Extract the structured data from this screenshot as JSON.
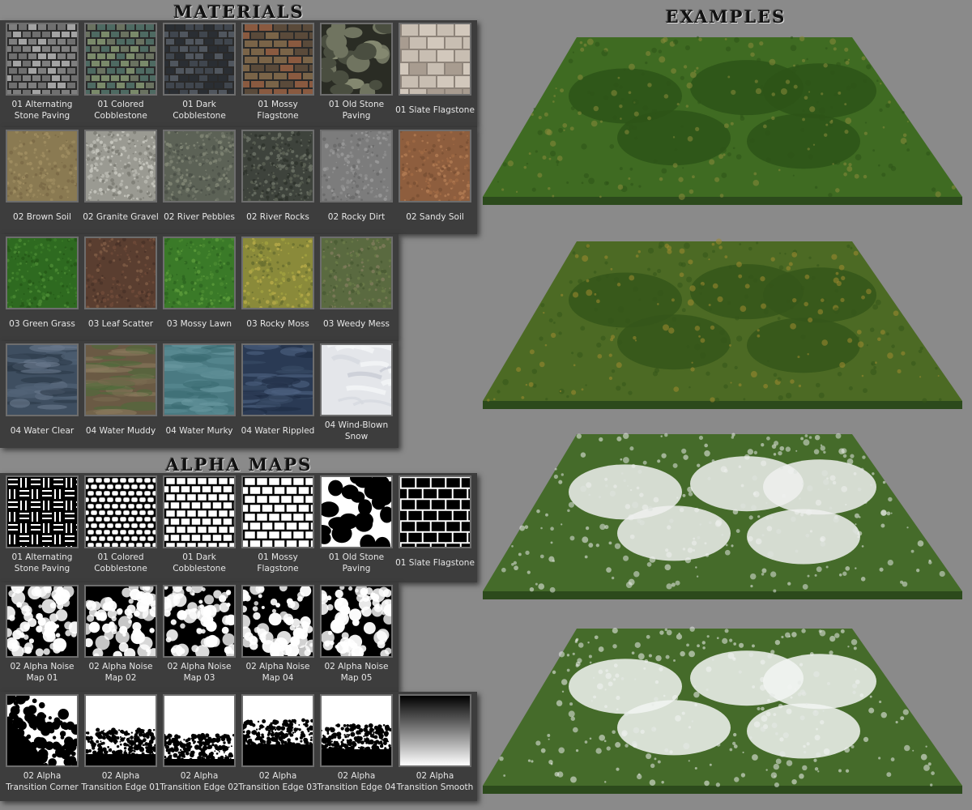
{
  "headings": {
    "materials": "MATERIALS",
    "alpha_maps": "ALPHA MAPS",
    "examples": "EXAMPLES"
  },
  "materials": [
    [
      {
        "label": "01 Alternating Stone Paving",
        "preview": "paving"
      },
      {
        "label": "01 Colored Cobblestone",
        "preview": "cobble-green"
      },
      {
        "label": "01 Dark Cobblestone",
        "preview": "cobble-dark"
      },
      {
        "label": "01 Mossy Flagstone",
        "preview": "brick-red"
      },
      {
        "label": "01 Old Stone Paving",
        "preview": "crazy-stone"
      },
      {
        "label": "01 Slate Flagstone",
        "preview": "slate-tiles"
      }
    ],
    [
      {
        "label": "02 Brown Soil",
        "preview": "soil-tan"
      },
      {
        "label": "02 Granite Gravel",
        "preview": "gravel-grey"
      },
      {
        "label": "02 River Pebbles",
        "preview": "pebbles-olive"
      },
      {
        "label": "02 River Rocks",
        "preview": "rocks-dark"
      },
      {
        "label": "02 Rocky Dirt",
        "preview": "dirt-grey"
      },
      {
        "label": "02 Sandy Soil",
        "preview": "soil-red"
      }
    ],
    [
      {
        "label": "03 Green Grass",
        "preview": "grass"
      },
      {
        "label": "03 Leaf Scatter",
        "preview": "leaves"
      },
      {
        "label": "03 Mossy Lawn",
        "preview": "lawn"
      },
      {
        "label": "03 Rocky Moss",
        "preview": "moss-yellow"
      },
      {
        "label": "03 Weedy Mess",
        "preview": "weeds"
      }
    ],
    [
      {
        "label": "04 Water Clear",
        "preview": "water-clear"
      },
      {
        "label": "04 Water Muddy",
        "preview": "water-muddy"
      },
      {
        "label": "04 Water Murky",
        "preview": "water-murky"
      },
      {
        "label": "04 Water Rippled",
        "preview": "water-ripple"
      },
      {
        "label": "04 Wind-Blown Snow",
        "preview": "snow"
      }
    ]
  ],
  "alpha_maps": [
    [
      {
        "label": "01 Alternating Stone Paving",
        "preview": "alpha-weave"
      },
      {
        "label": "01 Colored Cobblestone",
        "preview": "alpha-cobble"
      },
      {
        "label": "01 Dark Cobblestone",
        "preview": "alpha-brick-small"
      },
      {
        "label": "01 Mossy Flagstone",
        "preview": "alpha-brick"
      },
      {
        "label": "01 Old Stone Paving",
        "preview": "alpha-voronoi"
      },
      {
        "label": "01 Slate Flagstone",
        "preview": "alpha-grid"
      }
    ],
    [
      {
        "label": "02 Alpha Noise Map 01",
        "preview": "alpha-noise"
      },
      {
        "label": "02 Alpha Noise Map 02",
        "preview": "alpha-noise"
      },
      {
        "label": "02 Alpha Noise Map 03",
        "preview": "alpha-noise"
      },
      {
        "label": "02 Alpha Noise Map 04",
        "preview": "alpha-noise"
      },
      {
        "label": "02 Alpha Noise Map 05",
        "preview": "alpha-noise"
      }
    ],
    [
      {
        "label": "02 Alpha Transition Corner",
        "preview": "alpha-corner"
      },
      {
        "label": "02 Alpha Transition Edge 01",
        "preview": "alpha-edge"
      },
      {
        "label": "02 Alpha Transition Edge 02",
        "preview": "alpha-edge"
      },
      {
        "label": "02 Alpha Transition Edge 03",
        "preview": "alpha-edge"
      },
      {
        "label": "02 Alpha Transition Edge 04",
        "preview": "alpha-edge"
      },
      {
        "label": "02 Alpha Transition Smooth",
        "preview": "alpha-gradient"
      }
    ]
  ],
  "examples": [
    {
      "preview": "terrain-grass",
      "colors": {
        "base": "#3f6b22",
        "hill": "#2d5418",
        "accent": "#8a8a3a"
      }
    },
    {
      "preview": "terrain-moss",
      "colors": {
        "base": "#4c6a24",
        "hill": "#35561a",
        "accent": "#a08a30"
      }
    },
    {
      "preview": "terrain-snow-partial",
      "colors": {
        "base": "#456b2a",
        "hill": "#eef0ee",
        "accent": "#dfe3df"
      }
    },
    {
      "preview": "terrain-snow-heavy",
      "colors": {
        "base": "#456b2a",
        "hill": "#f2f4f2",
        "accent": "#e6e9e6"
      }
    }
  ]
}
